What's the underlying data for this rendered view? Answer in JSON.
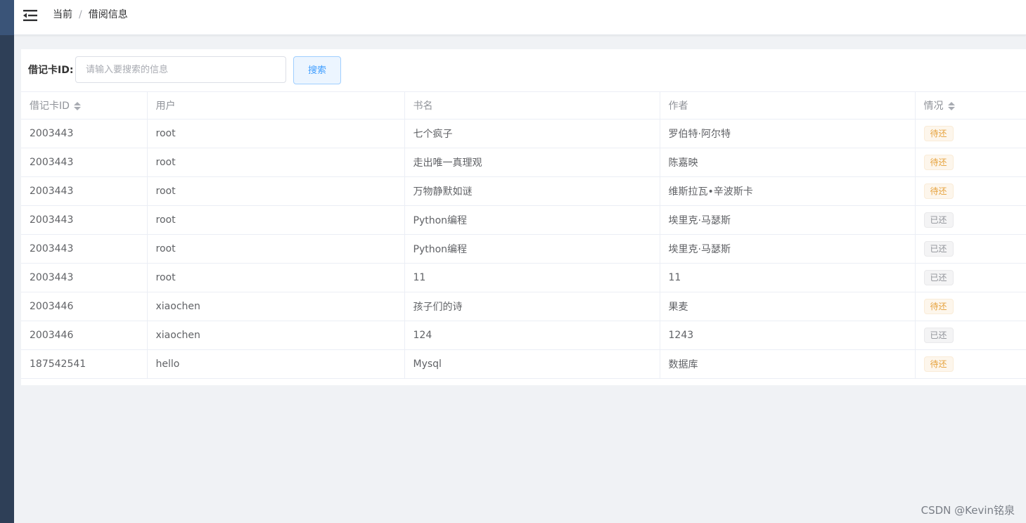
{
  "header": {
    "breadcrumb": [
      "当前",
      "借阅信息"
    ],
    "breadcrumb_separator": "/",
    "menu_icon": "menu-fold-icon"
  },
  "search": {
    "label": "借记卡ID:",
    "placeholder": "请输入要搜索的信息",
    "value": "",
    "button_label": "搜索"
  },
  "table": {
    "columns": [
      {
        "label": "借记卡ID",
        "sortable": true
      },
      {
        "label": "用户",
        "sortable": false
      },
      {
        "label": "书名",
        "sortable": false
      },
      {
        "label": "作者",
        "sortable": false
      },
      {
        "label": "情况",
        "sortable": true
      }
    ],
    "rows": [
      {
        "card_id": "2003443",
        "user": "root",
        "book": "七个疯子",
        "author": "罗伯特·阿尔特",
        "status": "待还",
        "status_type": "warning"
      },
      {
        "card_id": "2003443",
        "user": "root",
        "book": "走出唯一真理观",
        "author": "陈嘉映",
        "status": "待还",
        "status_type": "warning"
      },
      {
        "card_id": "2003443",
        "user": "root",
        "book": "万物静默如谜",
        "author": "维斯拉瓦•辛波斯卡",
        "status": "待还",
        "status_type": "warning"
      },
      {
        "card_id": "2003443",
        "user": "root",
        "book": "Python编程",
        "author": "埃里克·马瑟斯",
        "status": "已还",
        "status_type": "info"
      },
      {
        "card_id": "2003443",
        "user": "root",
        "book": "Python编程",
        "author": "埃里克·马瑟斯",
        "status": "已还",
        "status_type": "info"
      },
      {
        "card_id": "2003443",
        "user": "root",
        "book": "11",
        "author": "11",
        "status": "已还",
        "status_type": "info"
      },
      {
        "card_id": "2003446",
        "user": "xiaochen",
        "book": "孩子们的诗",
        "author": "果麦",
        "status": "待还",
        "status_type": "warning"
      },
      {
        "card_id": "2003446",
        "user": "xiaochen",
        "book": "124",
        "author": "1243",
        "status": "已还",
        "status_type": "info"
      },
      {
        "card_id": "187542541",
        "user": "hello",
        "book": "Mysql",
        "author": "数据库",
        "status": "待还",
        "status_type": "warning"
      }
    ]
  },
  "watermark": "CSDN @Kevin铭泉",
  "colors": {
    "sidebar": "#2e3f57",
    "accent": "#409eff",
    "tag_warning": "#e6a23c",
    "tag_info": "#909399"
  }
}
